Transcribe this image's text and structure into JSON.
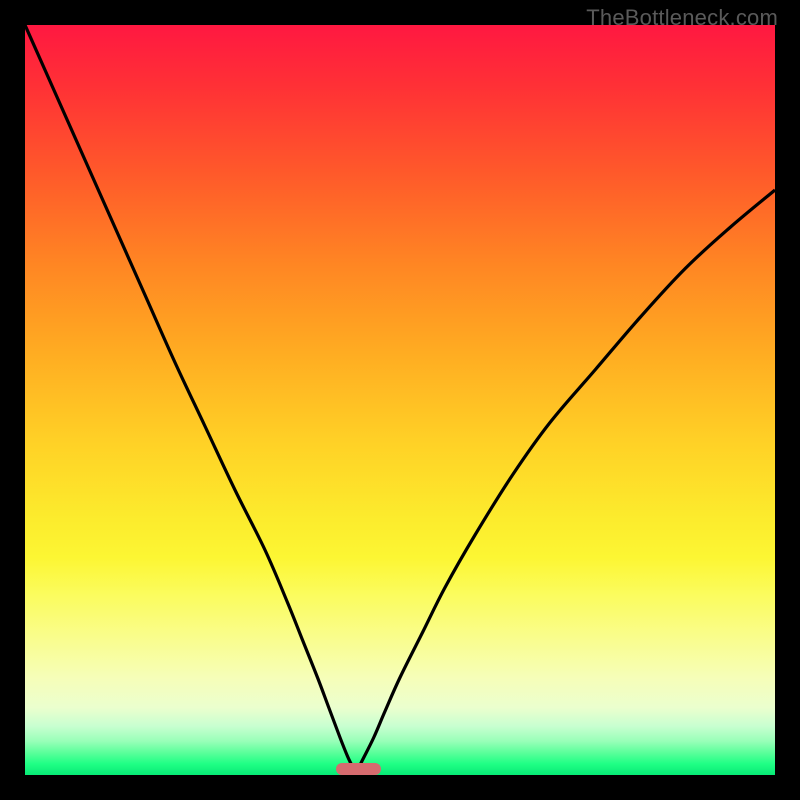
{
  "watermark": "TheBottleneck.com",
  "colors": {
    "frame": "#000000",
    "curve": "#000000",
    "marker": "#d66b6f",
    "gradient_top": "#ff1841",
    "gradient_bottom": "#07ea76"
  },
  "chart_data": {
    "type": "line",
    "title": "",
    "xlabel": "",
    "ylabel": "",
    "xlim": [
      0,
      100
    ],
    "ylim": [
      0,
      100
    ],
    "grid": false,
    "optimum_x": 44,
    "marker": {
      "x_min": 41.5,
      "x_max": 47.5,
      "y": 0,
      "height": 1.6
    },
    "series": [
      {
        "name": "left-curve",
        "x": [
          0,
          4,
          8,
          12,
          16,
          20,
          24,
          28,
          32,
          35,
          37,
          39,
          40.5,
          42,
          43,
          43.7,
          44
        ],
        "y": [
          100,
          91,
          82,
          73,
          64,
          55,
          46.5,
          38,
          30,
          23,
          18,
          13,
          9,
          5,
          2.5,
          1,
          0
        ]
      },
      {
        "name": "right-curve",
        "x": [
          44,
          45,
          46.5,
          48,
          50,
          53,
          56,
          60,
          65,
          70,
          76,
          82,
          88,
          94,
          100
        ],
        "y": [
          0,
          2,
          5,
          8.5,
          13,
          19,
          25,
          32,
          40,
          47,
          54,
          61,
          67.5,
          73,
          78
        ]
      }
    ]
  }
}
